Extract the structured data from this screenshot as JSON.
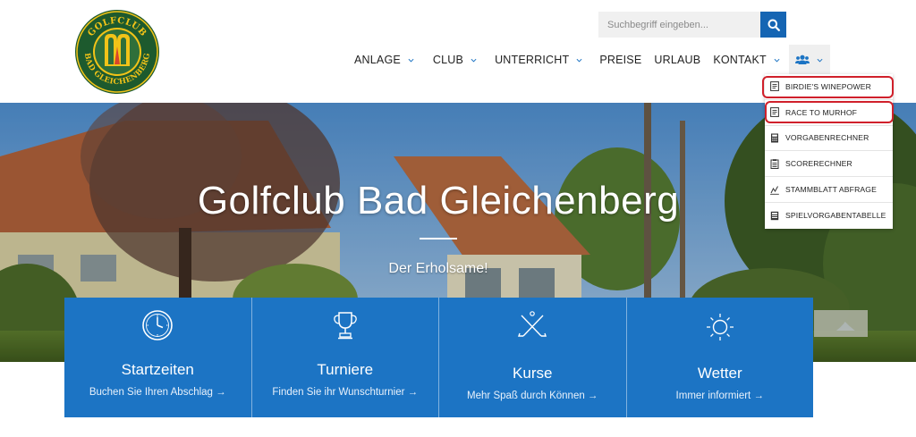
{
  "logo": {
    "top_text": "GOLFCLUB",
    "bottom_text": "BAD GLEICHENBERG"
  },
  "search": {
    "placeholder": "Suchbegriff eingeben...",
    "icon": "search-icon"
  },
  "nav": {
    "items": [
      {
        "label": "ANLAGE",
        "has_dropdown": true
      },
      {
        "label": "CLUB",
        "has_dropdown": true
      },
      {
        "label": "UNTERRICHT",
        "has_dropdown": true
      },
      {
        "label": "PREISE",
        "has_dropdown": false
      },
      {
        "label": "URLAUB",
        "has_dropdown": false
      },
      {
        "label": "KONTAKT",
        "has_dropdown": true
      }
    ],
    "members_icon": "users-icon"
  },
  "hero": {
    "title": "Golfclub Bad Gleichenberg",
    "subtitle": "Der Erholsame!"
  },
  "features": [
    {
      "icon": "clock-icon",
      "title": "Startzeiten",
      "link": "Buchen Sie Ihren Abschlag →"
    },
    {
      "icon": "trophy-icon",
      "title": "Turniere",
      "link": "Finden Sie ihr Wunschturnier →"
    },
    {
      "icon": "golf-clubs-icon",
      "title": "Kurse",
      "link": "Mehr Spaß durch Können →"
    },
    {
      "icon": "sun-icon",
      "title": "Wetter",
      "link": "Immer informiert →"
    }
  ],
  "members_menu": {
    "items": [
      {
        "label": "BIRDIE'S WINEPOWER",
        "icon": "document-icon",
        "highlighted": true
      },
      {
        "label": "RACE TO MURHOF",
        "icon": "document-icon",
        "highlighted": true
      },
      {
        "label": "VORGABENRECHNER",
        "icon": "calculator-icon",
        "highlighted": false
      },
      {
        "label": "SCORERECHNER",
        "icon": "scorecard-icon",
        "highlighted": false
      },
      {
        "label": "STAMMBLATT ABFRAGE",
        "icon": "chart-icon",
        "highlighted": false
      },
      {
        "label": "SPIELVORGABENTABELLE",
        "icon": "table-icon",
        "highlighted": false
      }
    ]
  },
  "colors": {
    "brand_blue": "#1c74c4",
    "search_blue": "#1565b3",
    "highlight_red": "#d0202b",
    "logo_green": "#1d5a2e",
    "logo_yellow": "#f2c318"
  }
}
